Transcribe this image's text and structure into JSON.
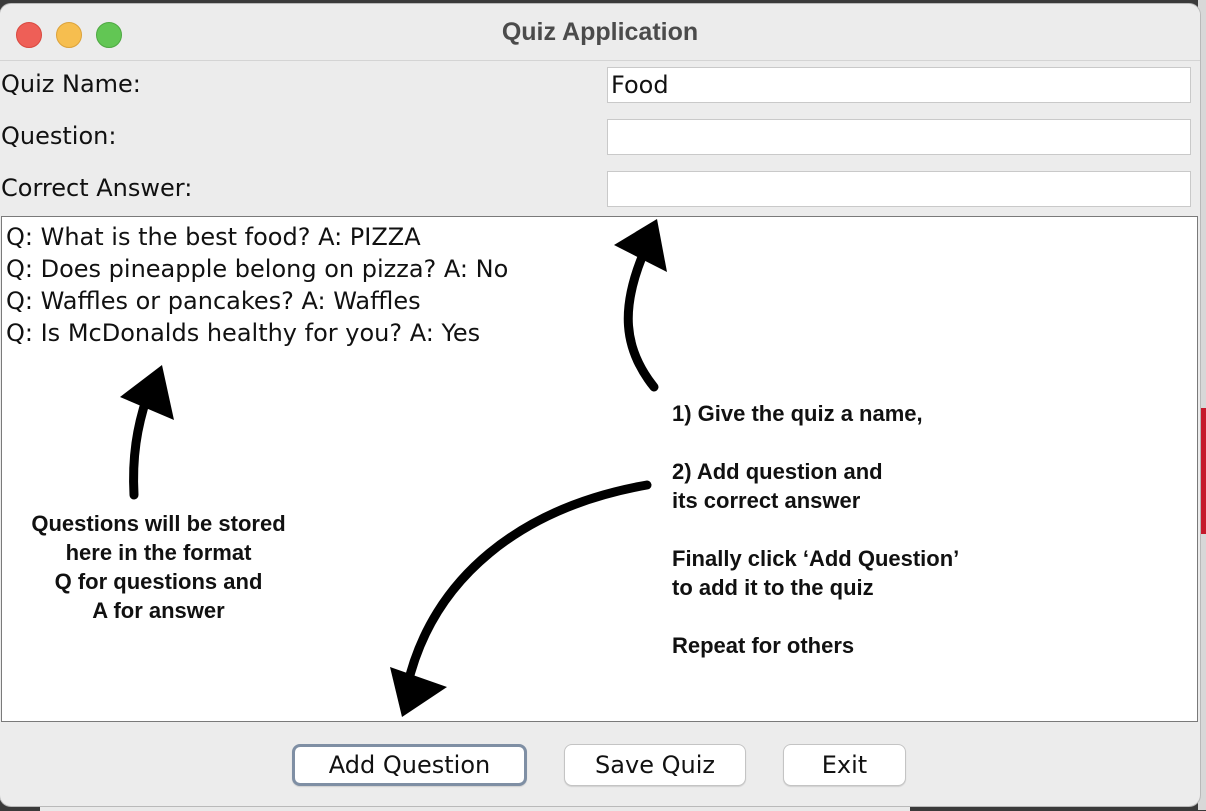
{
  "window": {
    "title": "Quiz Application"
  },
  "form": {
    "quiz_name_label": "Quiz Name:",
    "quiz_name_value": "Food",
    "question_label": "Question:",
    "question_value": "",
    "answer_label": "Correct Answer:",
    "answer_value": ""
  },
  "questions": [
    "Q: What is the best food? A: PIZZA",
    "Q: Does pineapple belong on pizza? A: No",
    "Q: Waffles or pancakes? A: Waffles",
    "Q: Is McDonalds healthy for you? A: Yes"
  ],
  "annotations": {
    "left_note": [
      "Questions will be stored",
      "here in the format",
      "Q for questions and",
      "A for answer"
    ],
    "step1": "1) Give the quiz a name,",
    "step2": [
      "2) Add question and",
      "its correct answer"
    ],
    "step3": [
      "Finally click ‘Add Question’",
      "to add it to the quiz"
    ],
    "step4": "Repeat for others"
  },
  "buttons": {
    "add_question": "Add Question",
    "save_quiz": "Save Quiz",
    "exit": "Exit"
  },
  "colors": {
    "close": "#ee5f57",
    "minimize": "#f6be4f",
    "maximize": "#62c654",
    "window_bg": "#ececec",
    "focus_border": "#7f8fa4"
  }
}
